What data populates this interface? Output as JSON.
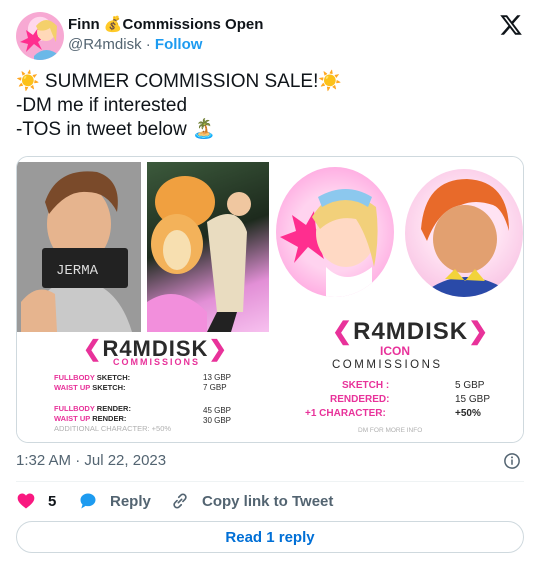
{
  "author": {
    "name": "Finn 💰Commissions Open",
    "handle": "@R4mdisk",
    "separator": "·",
    "follow_label": "Follow",
    "avatar_icon": "avatar-illustration"
  },
  "platform_icon": "x-logo-icon",
  "tweet": {
    "lines": [
      "☀️ SUMMER COMMISSION SALE!☀️",
      "-DM me if interested",
      "-TOS in tweet below 🏝️"
    ]
  },
  "media": {
    "left_card": {
      "sign_text": "JERMA",
      "brand": "R4MDISK",
      "subtitle": "COMMISSIONS",
      "rows": [
        {
          "label_pink": "FULLBODY",
          "label_rest": "SKETCH:",
          "value": "13 GBP"
        },
        {
          "label_pink": "WAIST UP",
          "label_rest": "SKETCH:",
          "value": "7 GBP"
        },
        {
          "label_pink": "FULLBODY",
          "label_rest": "RENDER:",
          "value": "45 GBP"
        },
        {
          "label_pink": "WAIST UP",
          "label_rest": "RENDER:",
          "value": "30 GBP"
        }
      ],
      "extra": "ADDITIONAL CHARACTER: +50%"
    },
    "right_card": {
      "brand": "R4MDISK",
      "subtitle_1": "ICON",
      "subtitle_2": "COMMISSIONS",
      "rows": [
        {
          "label": "SKETCH :",
          "value": "5 GBP"
        },
        {
          "label": "RENDERED:",
          "value": "15 GBP"
        },
        {
          "label": "+1 CHARACTER:",
          "value": "+50%"
        }
      ],
      "footer": "DM FOR MORE INFO"
    }
  },
  "meta": {
    "timestamp": "1:32 AM · Jul 22, 2023",
    "info_icon": "info-icon"
  },
  "actions": {
    "likes": "5",
    "reply_label": "Reply",
    "copy_label": "Copy link to Tweet"
  },
  "read_replies_label": "Read 1 reply",
  "colors": {
    "accent": "#1d9bf0",
    "like": "#f91880",
    "brand_pink": "#e8329a"
  }
}
